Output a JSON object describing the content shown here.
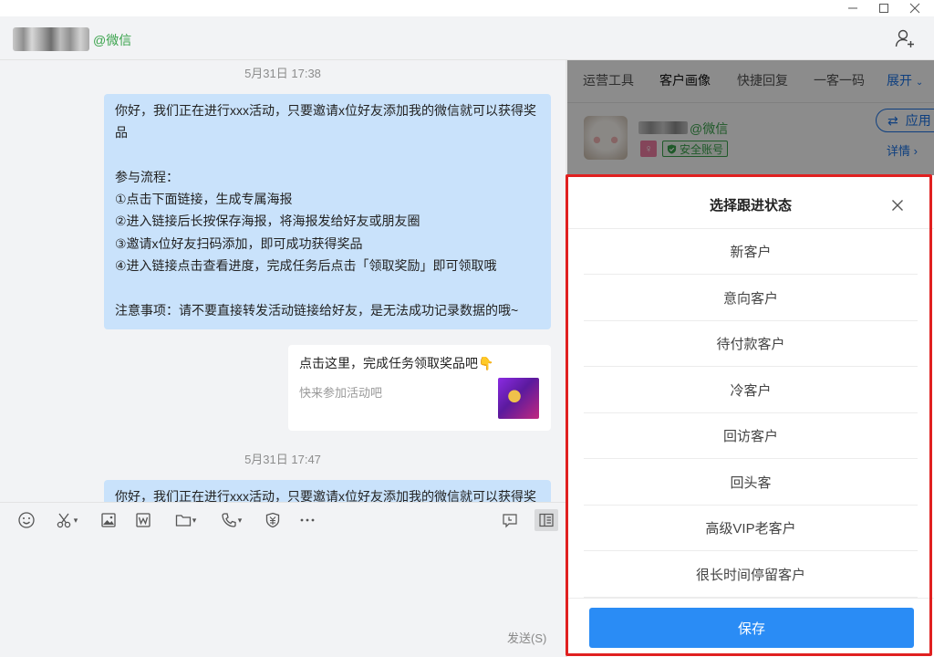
{
  "header": {
    "contact_tag": "@微信"
  },
  "chat": {
    "messages": [
      {
        "time": "5月31日 17:38",
        "lines": [
          "你好，我们正在进行xxx活动，只要邀请x位好友添加我的微信就可以获得奖",
          "品",
          "",
          "参与流程：",
          "①点击下面链接，生成专属海报",
          "②进入链接后长按保存海报，将海报发给好友或朋友圈",
          "③邀请x位好友扫码添加，即可成功获得奖品",
          "④进入链接点击查看进度，完成任务后点击「领取奖励」即可领取哦",
          "",
          "注意事项：请不要直接转发活动链接给好友，是无法成功记录数据的哦~"
        ]
      },
      {
        "link_card": {
          "title": "点击这里，完成任务领取奖品吧👇",
          "desc": "快来参加活动吧"
        }
      },
      {
        "time": "5月31日 17:47",
        "lines": [
          "你好，我们正在进行xxx活动，只要邀请x位好友添加我的微信就可以获得奖"
        ]
      }
    ]
  },
  "input": {
    "send_label": "发送(S)"
  },
  "right_panel": {
    "tabs": [
      "运营工具",
      "客户画像",
      "快捷回复",
      "一客一码"
    ],
    "expand_label": "展开",
    "profile": {
      "tag": "@微信",
      "safe_label": "安全账号",
      "gender_symbol": "♀",
      "apply_label": "应用",
      "detail_label": "详情"
    }
  },
  "followup_sheet": {
    "title": "选择跟进状态",
    "options": [
      "新客户",
      "意向客户",
      "待付款客户",
      "冷客户",
      "回访客户",
      "回头客",
      "高级VIP老客户",
      "很长时间停留客户"
    ],
    "save_label": "保存"
  },
  "colors": {
    "accent": "#2a8cf5",
    "brand_green": "#3aa34c",
    "highlight": "#e02020",
    "bubble": "#c9e2fb"
  }
}
